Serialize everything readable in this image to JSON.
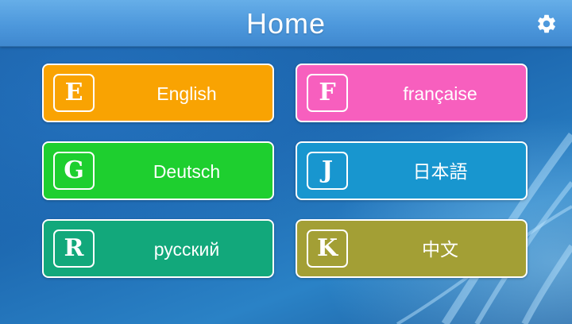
{
  "header": {
    "title": "Home",
    "settings_icon": "gear-icon"
  },
  "languages": [
    {
      "letter": "E",
      "label": "English",
      "color": "#f9a302"
    },
    {
      "letter": "F",
      "label": "française",
      "color": "#f75fbe"
    },
    {
      "letter": "G",
      "label": "Deutsch",
      "color": "#1ecf2f"
    },
    {
      "letter": "J",
      "label": "日本語",
      "color": "#1896cf"
    },
    {
      "letter": "R",
      "label": "русский",
      "color": "#12a87b"
    },
    {
      "letter": "K",
      "label": "中文",
      "color": "#a39f35"
    }
  ]
}
